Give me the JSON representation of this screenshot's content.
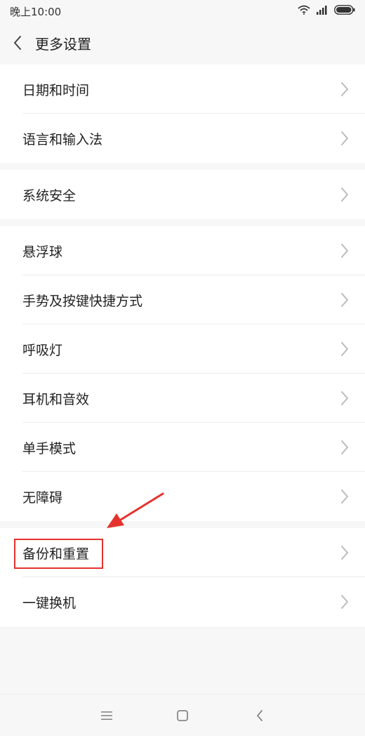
{
  "status_bar": {
    "time": "晚上10:00",
    "icons": [
      "wifi-icon",
      "signal-icon",
      "battery-icon"
    ]
  },
  "header": {
    "title": "更多设置",
    "back_icon": "chevron-left-icon"
  },
  "sections": [
    {
      "items": [
        "日期和时间",
        "语言和输入法"
      ]
    },
    {
      "items": [
        "系统安全"
      ]
    },
    {
      "items": [
        "悬浮球",
        "手势及按键快捷方式",
        "呼吸灯",
        "耳机和音效",
        "单手模式",
        "无障碍"
      ]
    },
    {
      "items": [
        "备份和重置",
        "一键换机"
      ]
    }
  ],
  "annotation": {
    "highlighted_item": "备份和重置",
    "color": "#e5322d"
  },
  "nav_bar": {
    "buttons": [
      "menu-icon",
      "home-icon",
      "back-icon"
    ]
  },
  "colors": {
    "background": "#f7f7f7",
    "card": "#ffffff",
    "text": "#222222",
    "chevron": "#bbbbbb"
  }
}
